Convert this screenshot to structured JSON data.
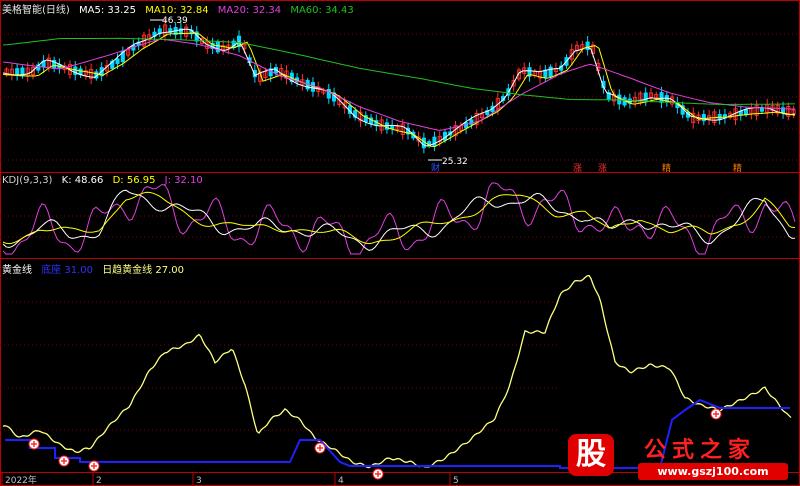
{
  "main": {
    "title": "美格智能(日线)",
    "ma": [
      {
        "label": "MA5: 33.25",
        "color": "#ffffff"
      },
      {
        "label": "MA10: 32.84",
        "color": "#ffff00"
      },
      {
        "label": "MA20: 32.34",
        "color": "#e040e0"
      },
      {
        "label": "MA60: 34.43",
        "color": "#20c020"
      }
    ],
    "high_label": "46.39",
    "low_label": "25.32",
    "markers": [
      "财",
      "涨",
      "涨",
      "精",
      "精"
    ]
  },
  "kdj": {
    "title": "KDJ(9,3,3)",
    "k": "K: 48.66",
    "d": "D: 56.95",
    "j": "J: 32.10"
  },
  "gold": {
    "title": "黄金线",
    "lines": [
      {
        "label": "底座  31.00",
        "color": "#2020ff"
      },
      {
        "label": "日趋黄金线  27.00",
        "color": "#ffff80"
      }
    ]
  },
  "xaxis": [
    "2022年",
    "2",
    "3",
    "4",
    "5"
  ],
  "watermark": {
    "brand": "股",
    "text": "公式之家",
    "url": "www.gszj100.com"
  },
  "colors": {
    "up": "#ff3030",
    "down": "#00d8ff",
    "grid": "#800000",
    "axis": "#c00000"
  },
  "chart_data": [
    {
      "type": "candlestick",
      "title": "美格智能(日线)",
      "series": [
        {
          "name": "MA5",
          "values": [
            33.25
          ]
        },
        {
          "name": "MA10",
          "values": [
            32.84
          ]
        },
        {
          "name": "MA20",
          "values": [
            32.34
          ]
        },
        {
          "name": "MA60",
          "values": [
            34.43
          ]
        }
      ],
      "annotations": [
        "46.39",
        "25.32"
      ],
      "ylim": [
        24,
        48
      ]
    },
    {
      "type": "line",
      "title": "KDJ(9,3,3)",
      "series": [
        {
          "name": "K",
          "values": [
            48.66
          ]
        },
        {
          "name": "D",
          "values": [
            56.95
          ]
        },
        {
          "name": "J",
          "values": [
            32.1
          ]
        }
      ]
    },
    {
      "type": "line",
      "title": "黄金线",
      "series": [
        {
          "name": "底座",
          "values": [
            31.0
          ]
        },
        {
          "name": "日趋黄金线",
          "values": [
            27.0
          ]
        }
      ]
    }
  ]
}
